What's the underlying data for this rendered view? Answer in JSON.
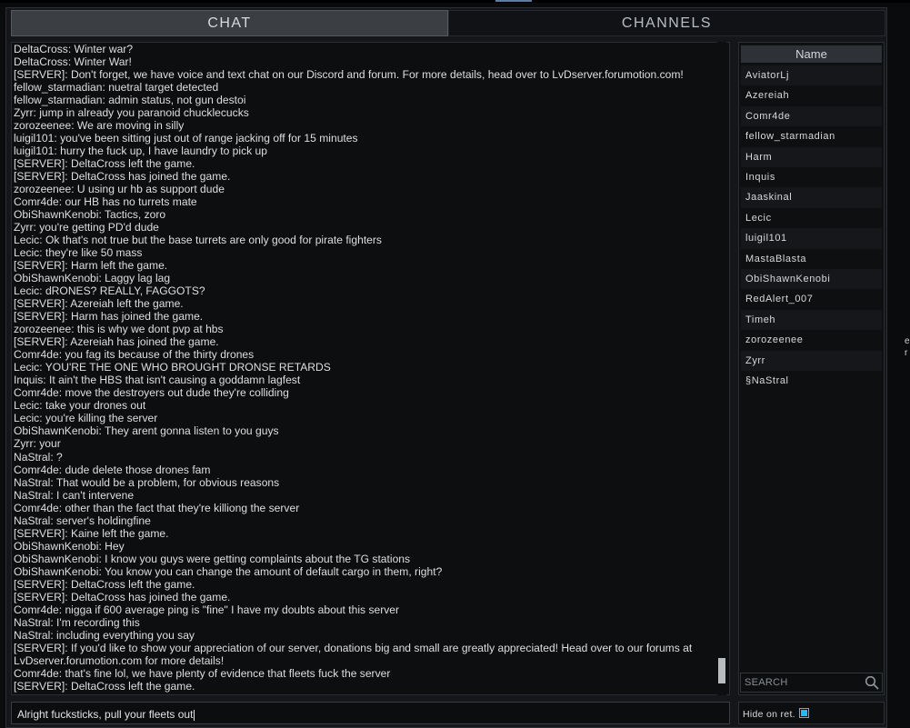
{
  "tabs": {
    "chat": "CHAT",
    "channels": "CHANNELS"
  },
  "chat": {
    "lines": [
      "DeltaCross: Winter war?",
      "DeltaCross: Winter War!",
      "[SERVER]: Don't forget, we have voice and text chat on our Discord and forum. For more details, head over to LvDserver.forumotion.com!",
      "fellow_starmadian: nuetral target detected",
      "fellow_starmadian: admin status, not gun destoi",
      "Zyrr: jump in already you paranoid chucklecucks",
      "zorozeenee: We are moving in silly",
      "luigil101: you've been sitting just out of range jacking off for 15 minutes",
      "luigil101: hurry the fuck up, I have laundry to pick up",
      "[SERVER]: DeltaCross left the game.",
      "[SERVER]: DeltaCross has joined the game.",
      "zorozeenee: U using ur hb as support dude",
      "Comr4de: our HB has no turrets mate",
      "ObiShawnKenobi: Tactics, zoro",
      "Zyrr: you're getting PD'd dude",
      "Lecic: Ok that's not true but the base turrets are only good for pirate fighters",
      "Lecic: they're like 50 mass",
      "[SERVER]: Harm left the game.",
      "ObiShawnKenobi: Laggy lag lag",
      "Lecic: dRONES? REALLY, FAGGOTS?",
      "[SERVER]: Azereiah left the game.",
      "[SERVER]: Harm has joined the game.",
      "zorozeenee: this is why we dont pvp at hbs",
      "[SERVER]: Azereiah has joined the game.",
      "Comr4de: you fag its because of the thirty drones",
      "Lecic: YOU'RE THE ONE WHO BROUGHT DRONSE RETARDS",
      "Inquis: It ain't the HBS that isn't causing a goddamn lagfest",
      "Comr4de: move the destroyers out dude they're colliding",
      "Lecic: take your drones out",
      "Lecic: you're killing the server",
      "ObiShawnKenobi: They arent gonna listen to you guys",
      "Zyrr: your",
      "NaStral: ?",
      "Comr4de: dude delete those drones fam",
      "NaStral: That would be a problem, for obvious reasons",
      "NaStral: I can't intervene",
      "Comr4de: other than the fact that they're killiong the server",
      "NaStral: server's holdingfine",
      "[SERVER]: Kaine left the game.",
      "ObiShawnKenobi: Hey",
      "ObiShawnKenobi: I know you guys were getting complaints about the TG stations",
      "ObiShawnKenobi: You know you can change the amount of default cargo in them, right?",
      "[SERVER]: DeltaCross left the game.",
      "[SERVER]: DeltaCross has joined the game.",
      "Comr4de: nigga if 600 average ping is \"fine\" I have my doubts about this server",
      "NaStral: I'm recording this",
      "NaStral: including everything you say",
      "[SERVER]: If you'd like to show your appreciation of our server, donations big and small are greatly appreciated! Head over to our forums at LvDserver.forumotion.com for more details!",
      "Comr4de: that's fine lol, we have plenty of evidence that fleets fuck the server",
      "[SERVER]: DeltaCross left the game."
    ],
    "input_value": "Alright fucksticks, pull your fleets out"
  },
  "players": {
    "header": "Name",
    "names": [
      "AviatorLj",
      "Azereiah",
      "Comr4de",
      "fellow_starmadian",
      "Harm",
      "Inquis",
      "Jaaskinal",
      "Lecic",
      "luigil101",
      "MastaBlasta",
      "ObiShawnKenobi",
      "RedAlert_007",
      "Timeh",
      "zorozeenee",
      "Zyrr",
      "§NaStral"
    ]
  },
  "search": {
    "placeholder": "SEARCH",
    "icon": "magnifier-icon"
  },
  "hide_on_ret": {
    "label": "Hide on ret.",
    "checked": true
  },
  "edge_fragments": [
    "e",
    "r"
  ],
  "colors": {
    "accent": "#29b8f5",
    "tab_active": "#3b3f44",
    "panel_bg": "#0d0e10",
    "text": "#dedfe1"
  }
}
